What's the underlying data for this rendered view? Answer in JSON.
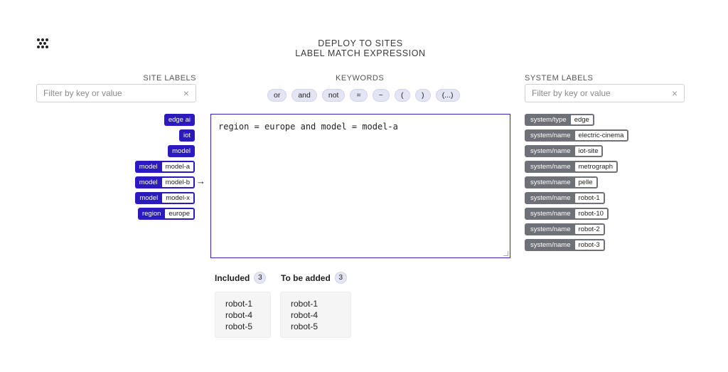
{
  "header": {
    "line1": "DEPLOY TO SITES",
    "line2": "LABEL MATCH EXPRESSION"
  },
  "site_labels": {
    "title": "SITE LABELS",
    "filter_placeholder": "Filter by key or value",
    "clear_icon": "×",
    "items": [
      {
        "key": "edge ai",
        "value": null
      },
      {
        "key": "iot",
        "value": null
      },
      {
        "key": "model",
        "value": null
      },
      {
        "key": "model",
        "value": "model-a"
      },
      {
        "key": "model",
        "value": "model-b"
      },
      {
        "key": "model",
        "value": "model-x"
      },
      {
        "key": "region",
        "value": "europe"
      }
    ],
    "arrow": "→"
  },
  "keywords": {
    "title": "KEYWORDS",
    "items": [
      "or",
      "and",
      "not",
      "=",
      "~",
      "(",
      ")",
      "(...)"
    ]
  },
  "expression": "region = europe and model = model-a",
  "system_labels": {
    "title": "SYSTEM LABELS",
    "filter_placeholder": "Filter by key or value",
    "clear_icon": "×",
    "items": [
      {
        "key": "system/type",
        "value": "edge"
      },
      {
        "key": "system/name",
        "value": "electric-cinema"
      },
      {
        "key": "system/name",
        "value": "iot-site"
      },
      {
        "key": "system/name",
        "value": "metrograph"
      },
      {
        "key": "system/name",
        "value": "pelle"
      },
      {
        "key": "system/name",
        "value": "robot-1"
      },
      {
        "key": "system/name",
        "value": "robot-10"
      },
      {
        "key": "system/name",
        "value": "robot-2"
      },
      {
        "key": "system/name",
        "value": "robot-3"
      }
    ]
  },
  "included": {
    "label": "Included",
    "count": "3",
    "items": [
      "robot-1",
      "robot-4",
      "robot-5"
    ]
  },
  "to_be_added": {
    "label": "To be added",
    "count": "3",
    "items": [
      "robot-1",
      "robot-4",
      "robot-5"
    ]
  },
  "colors": {
    "accent": "#2a1ac0",
    "system_label": "#6f7178",
    "keyword_bg": "#e3e4f4"
  }
}
